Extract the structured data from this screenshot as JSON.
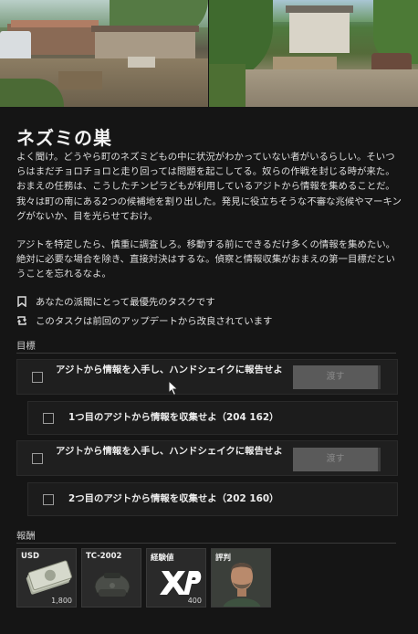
{
  "quest": {
    "title": "ネズミの巣",
    "description_1": "よく聞け。どうやら町のネズミどもの中に状況がわかっていない者がいるらしい。そいつらはまだチョロチョロと走り回っては問題を起こしてる。奴らの作戦を封じる時が来た。おまえの任務は、こうしたチンピラどもが利用しているアジトから情報を集めることだ。我々は町の南にある2つの候補地を割り出した。発見に役立ちそうな不審な兆候やマーキングがないか、目を光らせておけ。",
    "description_2": "アジトを特定したら、慎重に調査しろ。移動する前にできるだけ多くの情報を集めたい。絶対に必要な場合を除き、直接対決はするな。偵察と情報収集がおまえの第一目標だということを忘れるなよ。",
    "info_priority": "あなたの派閥にとって最優先のタスクです",
    "info_changed": "このタスクは前回のアップデートから改良されています",
    "objectives_label": "目標",
    "rewards_label": "報酬"
  },
  "icons": {
    "priority": "bookmark-icon",
    "changed": "refresh-icon"
  },
  "objectives": [
    {
      "text": "アジトから情報を入手し、ハンドシェイクに報告せよ",
      "button": "渡す",
      "button_enabled": false
    },
    {
      "text": "1つ目のアジトから情報を収集せよ（204 162）"
    },
    {
      "text": "アジトから情報を入手し、ハンドシェイクに報告せよ",
      "button": "渡す",
      "button_enabled": false
    },
    {
      "text": "2つ目のアジトから情報を収集せよ（202 160）"
    }
  ],
  "rewards": [
    {
      "label": "USD",
      "quantity": "1,800",
      "icon": "cash-icon"
    },
    {
      "label": "TC-2002",
      "quantity": "",
      "icon": "helmet-icon"
    },
    {
      "label": "経験値",
      "quantity": "400",
      "icon": "xp-icon"
    },
    {
      "label": "評判",
      "quantity": "",
      "icon": "trader-portrait-icon"
    }
  ],
  "colors": {
    "background": "#151515",
    "row": "#1f1f1f",
    "button_disabled": "#5a5a5a",
    "reputation_green": "#7bd64a"
  }
}
